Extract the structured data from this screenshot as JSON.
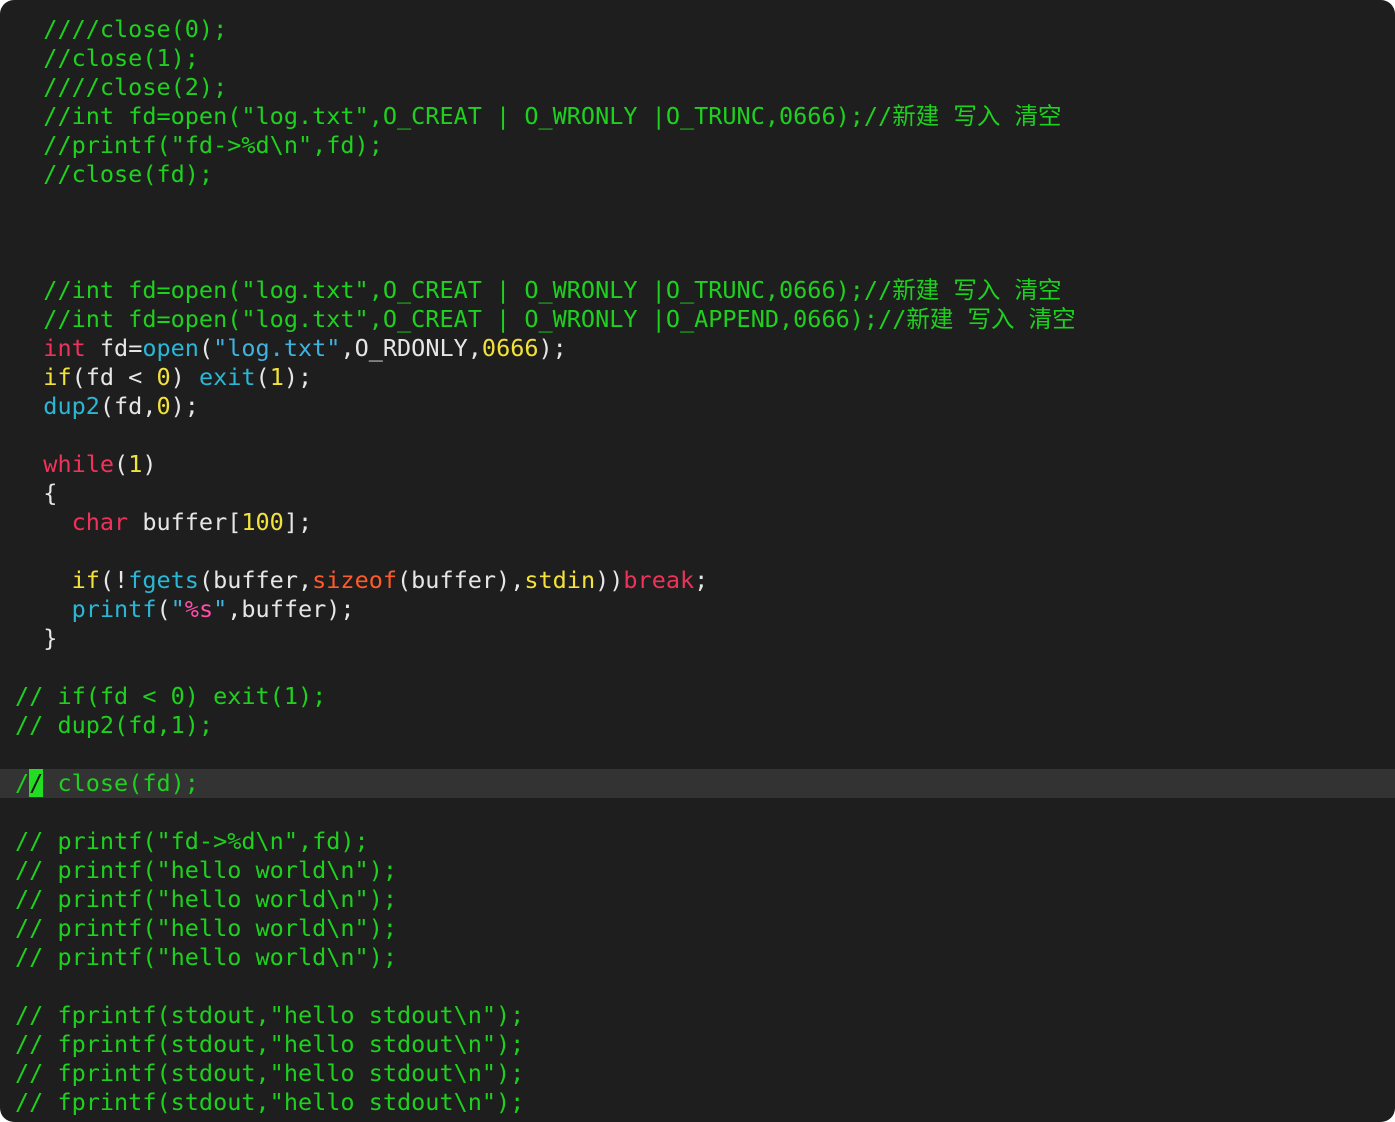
{
  "editor": {
    "colors": {
      "background": "#1e1e1e",
      "comment": "#1fd11f",
      "plain": "#e6e6e6",
      "keyword": "#f0325a",
      "type": "#f0325a",
      "conditional": "#f2e23a",
      "function": "#2ab7d6",
      "string": "#3fb3e0",
      "number": "#f2e23a",
      "format": "#ff4fa8",
      "builtin": "#ff5a2a",
      "stdin": "#f2e23a",
      "cursor": "#22dd22",
      "current_line": "#333333"
    },
    "lines": [
      {
        "segments": [
          {
            "text": "  ////close(0);",
            "style": "comment"
          }
        ]
      },
      {
        "segments": [
          {
            "text": "  //close(1);",
            "style": "comment"
          }
        ]
      },
      {
        "segments": [
          {
            "text": "  ////close(2);",
            "style": "comment"
          }
        ]
      },
      {
        "segments": [
          {
            "text": "  //int fd=open(\"log.txt\",O_CREAT | O_WRONLY |O_TRUNC,0666);//新建 写入 清空",
            "style": "comment"
          }
        ]
      },
      {
        "segments": [
          {
            "text": "  //printf(\"fd->%d\\n\",fd);",
            "style": "comment"
          }
        ]
      },
      {
        "segments": [
          {
            "text": "  //close(fd);",
            "style": "comment"
          }
        ]
      },
      {
        "segments": []
      },
      {
        "segments": []
      },
      {
        "segments": []
      },
      {
        "segments": [
          {
            "text": "  //int fd=open(\"log.txt\",O_CREAT | O_WRONLY |O_TRUNC,0666);//新建 写入 清空",
            "style": "comment"
          }
        ]
      },
      {
        "segments": [
          {
            "text": "  //int fd=open(\"log.txt\",O_CREAT | O_WRONLY |O_APPEND,0666);//新建 写入 清空",
            "style": "comment"
          }
        ]
      },
      {
        "segments": [
          {
            "text": "  ",
            "style": "plain"
          },
          {
            "text": "int",
            "style": "type"
          },
          {
            "text": " fd=",
            "style": "plain"
          },
          {
            "text": "open",
            "style": "function"
          },
          {
            "text": "(",
            "style": "plain"
          },
          {
            "text": "\"log.txt\"",
            "style": "string"
          },
          {
            "text": ",O_RDONLY,",
            "style": "plain"
          },
          {
            "text": "0666",
            "style": "number"
          },
          {
            "text": ");",
            "style": "plain"
          }
        ]
      },
      {
        "segments": [
          {
            "text": "  ",
            "style": "plain"
          },
          {
            "text": "if",
            "style": "conditional"
          },
          {
            "text": "(fd < ",
            "style": "plain"
          },
          {
            "text": "0",
            "style": "number"
          },
          {
            "text": ") ",
            "style": "plain"
          },
          {
            "text": "exit",
            "style": "function"
          },
          {
            "text": "(",
            "style": "plain"
          },
          {
            "text": "1",
            "style": "number"
          },
          {
            "text": ");",
            "style": "plain"
          }
        ]
      },
      {
        "segments": [
          {
            "text": "  ",
            "style": "plain"
          },
          {
            "text": "dup2",
            "style": "function"
          },
          {
            "text": "(fd,",
            "style": "plain"
          },
          {
            "text": "0",
            "style": "number"
          },
          {
            "text": ");",
            "style": "plain"
          }
        ]
      },
      {
        "segments": []
      },
      {
        "segments": [
          {
            "text": "  ",
            "style": "plain"
          },
          {
            "text": "while",
            "style": "keyword"
          },
          {
            "text": "(",
            "style": "plain"
          },
          {
            "text": "1",
            "style": "number"
          },
          {
            "text": ")",
            "style": "plain"
          }
        ]
      },
      {
        "segments": [
          {
            "text": "  {",
            "style": "plain"
          }
        ]
      },
      {
        "segments": [
          {
            "text": "    ",
            "style": "plain"
          },
          {
            "text": "char",
            "style": "type"
          },
          {
            "text": " buffer[",
            "style": "plain"
          },
          {
            "text": "100",
            "style": "number"
          },
          {
            "text": "];",
            "style": "plain"
          }
        ]
      },
      {
        "segments": []
      },
      {
        "segments": [
          {
            "text": "    ",
            "style": "plain"
          },
          {
            "text": "if",
            "style": "conditional"
          },
          {
            "text": "(!",
            "style": "plain"
          },
          {
            "text": "fgets",
            "style": "function"
          },
          {
            "text": "(buffer,",
            "style": "plain"
          },
          {
            "text": "sizeof",
            "style": "builtin"
          },
          {
            "text": "(buffer),",
            "style": "plain"
          },
          {
            "text": "stdin",
            "style": "stdin"
          },
          {
            "text": "))",
            "style": "plain"
          },
          {
            "text": "break",
            "style": "keyword"
          },
          {
            "text": ";",
            "style": "plain"
          }
        ]
      },
      {
        "segments": [
          {
            "text": "    ",
            "style": "plain"
          },
          {
            "text": "printf",
            "style": "function"
          },
          {
            "text": "(",
            "style": "plain"
          },
          {
            "text": "\"",
            "style": "string"
          },
          {
            "text": "%s",
            "style": "format"
          },
          {
            "text": "\"",
            "style": "string"
          },
          {
            "text": ",buffer);",
            "style": "plain"
          }
        ]
      },
      {
        "segments": [
          {
            "text": "  }",
            "style": "plain"
          }
        ]
      },
      {
        "segments": []
      },
      {
        "segments": [
          {
            "text": "// if(fd < 0) exit(1);",
            "style": "comment"
          }
        ]
      },
      {
        "segments": [
          {
            "text": "// dup2(fd,1);",
            "style": "comment"
          }
        ]
      },
      {
        "segments": []
      },
      {
        "current": true,
        "segments": [
          {
            "text": "/",
            "style": "comment"
          },
          {
            "text": "/",
            "style": "cursor"
          },
          {
            "text": " close(fd);",
            "style": "comment"
          }
        ]
      },
      {
        "segments": []
      },
      {
        "segments": [
          {
            "text": "// printf(\"fd->%d\\n\",fd);",
            "style": "comment"
          }
        ]
      },
      {
        "segments": [
          {
            "text": "// printf(\"hello world\\n\");",
            "style": "comment"
          }
        ]
      },
      {
        "segments": [
          {
            "text": "// printf(\"hello world\\n\");",
            "style": "comment"
          }
        ]
      },
      {
        "segments": [
          {
            "text": "// printf(\"hello world\\n\");",
            "style": "comment"
          }
        ]
      },
      {
        "segments": [
          {
            "text": "// printf(\"hello world\\n\");",
            "style": "comment"
          }
        ]
      },
      {
        "segments": []
      },
      {
        "segments": [
          {
            "text": "// fprintf(stdout,\"hello stdout\\n\");",
            "style": "comment"
          }
        ]
      },
      {
        "segments": [
          {
            "text": "// fprintf(stdout,\"hello stdout\\n\");",
            "style": "comment"
          }
        ]
      },
      {
        "segments": [
          {
            "text": "// fprintf(stdout,\"hello stdout\\n\");",
            "style": "comment"
          }
        ]
      },
      {
        "segments": [
          {
            "text": "// fprintf(stdout,\"hello stdout\\n\");",
            "style": "comment"
          }
        ]
      }
    ]
  }
}
